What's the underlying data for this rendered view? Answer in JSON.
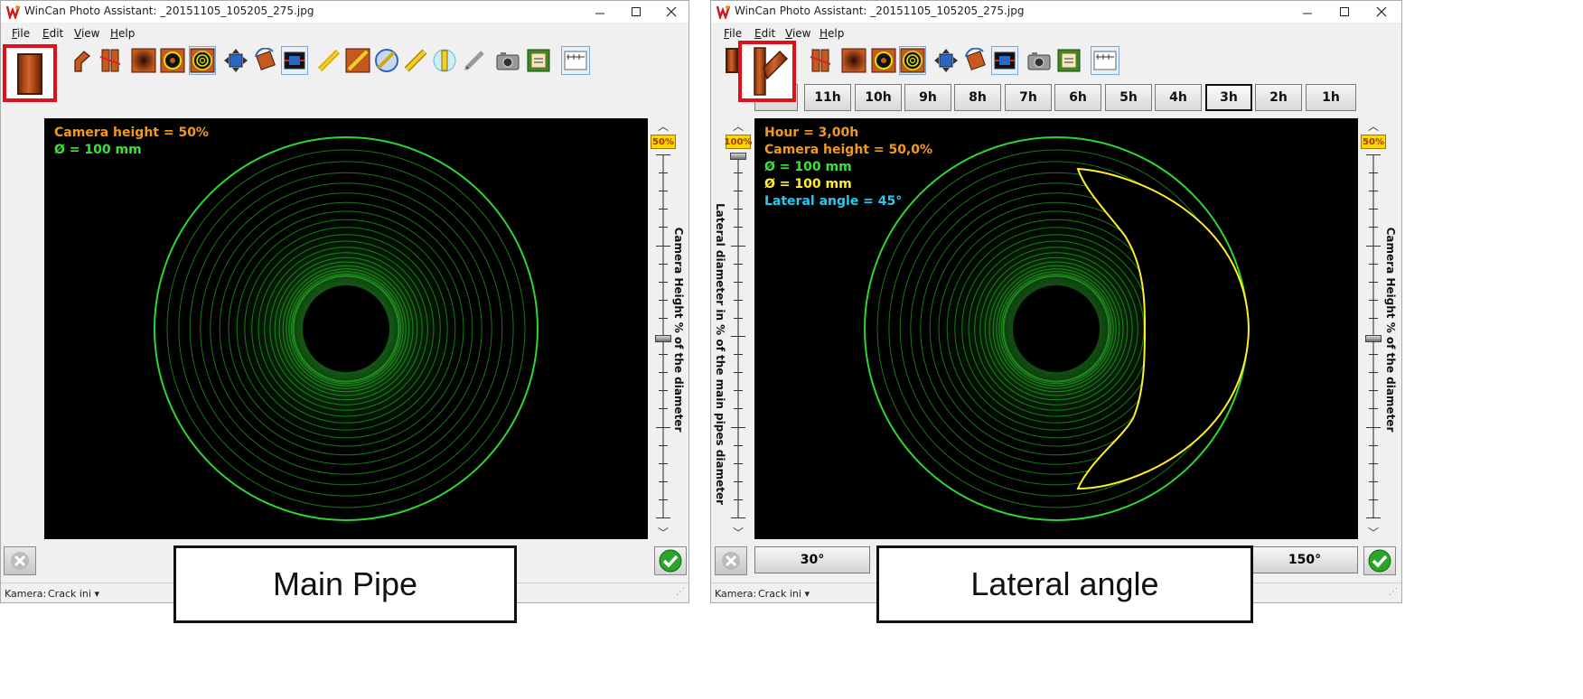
{
  "colors": {
    "overlay_orange": "#f39a1c",
    "overlay_green": "#3ce23c",
    "overlay_yellow": "#ffee2a",
    "overlay_cyan": "#27c9ee",
    "pipe_ring_green": "#2ed62e",
    "lateral_yellow": "#ffee2a",
    "highlight_red": "#e0101a"
  },
  "left_window": {
    "title": "WinCan Photo Assistant: _20151105_105205_275.jpg",
    "window_controls": [
      "minimize-icon",
      "maximize-icon",
      "close-icon"
    ],
    "menu": [
      {
        "key": "F",
        "rest": "ile"
      },
      {
        "key": "E",
        "rest": "dit"
      },
      {
        "key": "V",
        "rest": "iew"
      },
      {
        "key": "H",
        "rest": "elp"
      }
    ],
    "toolbar_icons": [
      "main-pipe-icon",
      "pipe-bend-icon",
      "pipe-offset-icon",
      "pipe-blur-icon",
      "ring-icon",
      "multi-ring-icon",
      "move-icon",
      "rotate-icon",
      "fit-icon",
      "measure-line-icon",
      "pipe-cut-icon",
      "hatch-circle-icon",
      "measure-alt-icon",
      "tube-gauge-icon",
      "pen-icon",
      "camera-icon",
      "save-photo-icon",
      "grid-ruler-icon"
    ],
    "overlay": {
      "camera_height": "Camera height = 50%",
      "diameter": "Ø = 100 mm"
    },
    "camera_slider": {
      "value_label": "50%",
      "axis_label": "Camera Height % of the diameter",
      "value": 0.5
    },
    "statusbar": {
      "label": "Kamera:",
      "value": "Crack ini"
    }
  },
  "right_window": {
    "title": "WinCan Photo Assistant: _20151105_105205_275.jpg",
    "window_controls": [
      "minimize-icon",
      "maximize-icon",
      "close-icon"
    ],
    "menu": [
      {
        "key": "F",
        "rest": "ile"
      },
      {
        "key": "E",
        "rest": "dit"
      },
      {
        "key": "V",
        "rest": "iew"
      },
      {
        "key": "H",
        "rest": "elp"
      }
    ],
    "toolbar_icons": [
      "main-pipe-icon",
      "lateral-pipe-icon",
      "pipe-offset-icon",
      "pipe-blur-icon",
      "ring-icon",
      "multi-ring-icon",
      "move-icon",
      "rotate-icon",
      "fit-icon",
      "camera-icon",
      "save-photo-icon",
      "grid-ruler-icon"
    ],
    "hours": [
      "11h",
      "10h",
      "9h",
      "8h",
      "7h",
      "6h",
      "5h",
      "4h",
      "3h",
      "2h",
      "1h"
    ],
    "active_hour": "3h",
    "overlay": {
      "hour": "Hour = 3,00h",
      "camera_height": "Camera height = 50,0%",
      "diameter_main": "Ø = 100 mm",
      "diameter_lateral": "Ø = 100 mm",
      "lateral_angle": "Lateral angle = 45°"
    },
    "lateral_slider": {
      "value_label": "100%",
      "axis_label": "Lateral diameter in % of the main pipes diameter",
      "value": 1.0
    },
    "camera_slider": {
      "value_label": "50%",
      "axis_label": "Camera Height % of the diameter",
      "value": 0.5
    },
    "angle_buttons": [
      "30°",
      "150°"
    ],
    "statusbar": {
      "label": "Kamera:",
      "value": "Crack ini"
    }
  },
  "captions": {
    "left": "Main Pipe",
    "right": "Lateral angle"
  }
}
